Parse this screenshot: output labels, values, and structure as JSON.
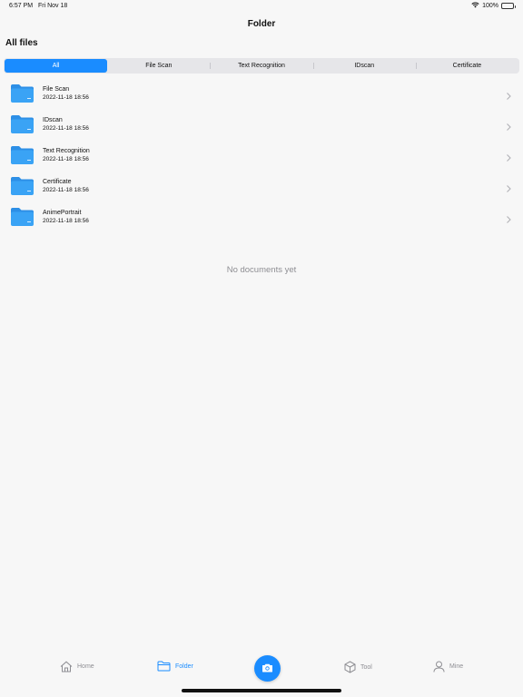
{
  "status_bar": {
    "time": "6:57 PM",
    "date": "Fri Nov 18",
    "battery": "100%"
  },
  "nav": {
    "title": "Folder"
  },
  "section": {
    "title": "All files"
  },
  "segments": [
    {
      "label": "All",
      "active": true
    },
    {
      "label": "File Scan",
      "active": false
    },
    {
      "label": "Text Recognition",
      "active": false
    },
    {
      "label": "IDscan",
      "active": false
    },
    {
      "label": "Certificate",
      "active": false
    }
  ],
  "folders": [
    {
      "name": "File Scan",
      "date": "2022-11-18 18:56"
    },
    {
      "name": "IDscan",
      "date": "2022-11-18 18:56"
    },
    {
      "name": "Text Recognition",
      "date": "2022-11-18 18:56"
    },
    {
      "name": "Certificate",
      "date": "2022-11-18 18:56"
    },
    {
      "name": "AnimePortrait",
      "date": "2022-11-18 18:56"
    }
  ],
  "empty_message": "No documents yet",
  "tabs": {
    "home": {
      "label": "Home",
      "icon": "home-icon"
    },
    "folder": {
      "label": "Folder",
      "icon": "folder-icon"
    },
    "camera": {
      "icon": "camera-icon"
    },
    "tool": {
      "label": "Tool",
      "icon": "cube-icon"
    },
    "mine": {
      "label": "Mine",
      "icon": "person-icon"
    }
  },
  "colors": {
    "accent": "#1a8cff",
    "folder_blue": "#3aa3f5",
    "inactive_tab": "#8e8e93"
  }
}
